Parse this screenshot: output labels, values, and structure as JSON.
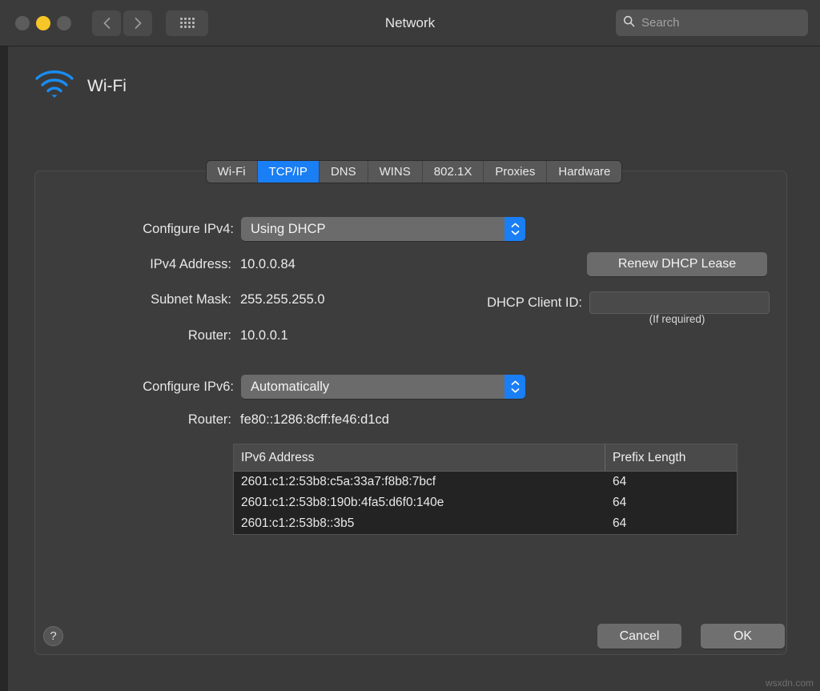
{
  "window": {
    "title": "Network",
    "traffic_lights": [
      "close",
      "minimize",
      "zoom"
    ]
  },
  "toolbar": {
    "back_icon": "chevron-left-icon",
    "forward_icon": "chevron-right-icon",
    "showall_icon": "grid-icon",
    "search": {
      "placeholder": "Search",
      "value": "",
      "icon": "search-icon"
    }
  },
  "service": {
    "icon": "wifi-icon",
    "name": "Wi-Fi",
    "accent_color": "#1a8cf0"
  },
  "tabs": [
    {
      "label": "Wi-Fi",
      "active": false
    },
    {
      "label": "TCP/IP",
      "active": true
    },
    {
      "label": "DNS",
      "active": false
    },
    {
      "label": "WINS",
      "active": false
    },
    {
      "label": "802.1X",
      "active": false
    },
    {
      "label": "Proxies",
      "active": false
    },
    {
      "label": "Hardware",
      "active": false
    }
  ],
  "selected_tab_color": "#1a7ef5",
  "ipv4": {
    "configure_label": "Configure IPv4:",
    "configure_value": "Using DHCP",
    "address_label": "IPv4 Address:",
    "address_value": "10.0.0.84",
    "subnet_label": "Subnet Mask:",
    "subnet_value": "255.255.255.0",
    "router_label": "Router:",
    "router_value": "10.0.0.1",
    "renew_button": "Renew DHCP Lease",
    "client_id_label": "DHCP Client ID:",
    "client_id_value": "",
    "client_id_hint": "(If required)"
  },
  "ipv6": {
    "configure_label": "Configure IPv6:",
    "configure_value": "Automatically",
    "router_label": "Router:",
    "router_value": "fe80::1286:8cff:fe46:d1cd",
    "table": {
      "columns": [
        "IPv6 Address",
        "Prefix Length"
      ],
      "rows": [
        {
          "address": "2601:c1:2:53b8:c5a:33a7:f8b8:7bcf",
          "prefix": "64"
        },
        {
          "address": "2601:c1:2:53b8:190b:4fa5:d6f0:140e",
          "prefix": "64"
        },
        {
          "address": "2601:c1:2:53b8::3b5",
          "prefix": "64"
        }
      ]
    }
  },
  "footer": {
    "help_label": "?",
    "cancel_label": "Cancel",
    "ok_label": "OK"
  },
  "watermark": "wsxdn.com"
}
